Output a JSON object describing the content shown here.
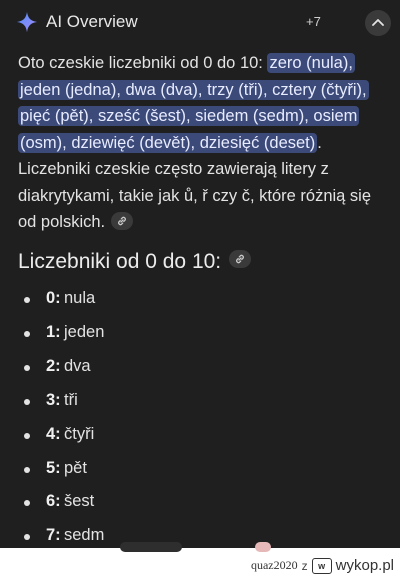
{
  "header": {
    "title": "AI Overview",
    "more_count": "+7"
  },
  "intro": {
    "lead": "Oto czeskie liczebniki od 0 do 10: ",
    "highlight": "zero (nula), jeden (jedna), dwa (dva), trzy (tři), cztery (čtyři), pięć (pět), sześć (šest), siedem (sedm), osiem (osm), dziewięć (devět), dziesięć (deset)",
    "tail": ". Liczebniki czeskie często zawierają litery z diakrytykami, takie jak ů, ř czy č, które różnią się od polskich."
  },
  "section_heading": "Liczebniki od 0 do 10:",
  "numerals": [
    {
      "num": "0:",
      "word": "nula"
    },
    {
      "num": "1:",
      "word": "jeden"
    },
    {
      "num": "2:",
      "word": "dva"
    },
    {
      "num": "3:",
      "word": "tři"
    },
    {
      "num": "4:",
      "word": "čtyři"
    },
    {
      "num": "5:",
      "word": "pět"
    },
    {
      "num": "6:",
      "word": "šest"
    },
    {
      "num": "7:",
      "word": "sedm"
    }
  ],
  "watermark": {
    "user": "quaz2020",
    "sep": "z",
    "logo": "w",
    "site": "wykop.pl"
  },
  "colors": {
    "background": "#1f1f1f",
    "highlight": "#3c4a7a",
    "accent": "#8ab4f8"
  }
}
